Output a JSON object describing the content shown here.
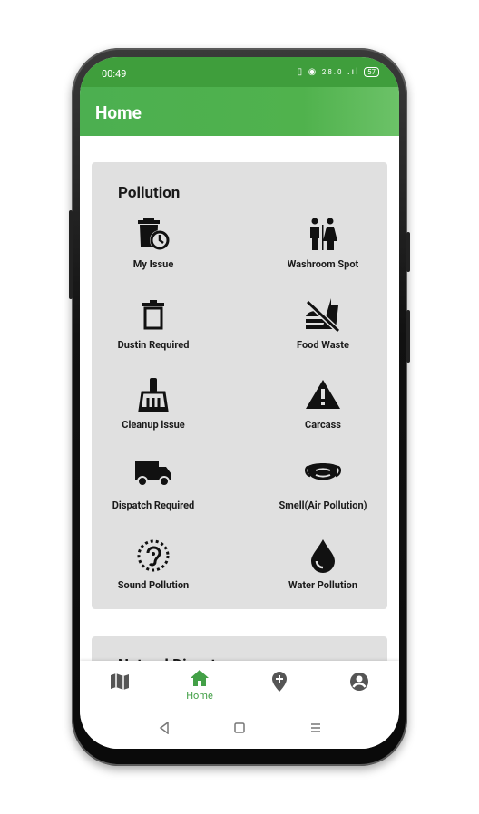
{
  "status_bar": {
    "time": "00:49",
    "icons_text": "28.0 KB/S ⁴ᴳ 4G",
    "battery": "57"
  },
  "app_bar": {
    "title": "Home"
  },
  "pollution_card": {
    "title": "Pollution",
    "items": [
      {
        "label": "My Issue",
        "icon": "trash-clock-icon"
      },
      {
        "label": "Washroom Spot",
        "icon": "washroom-icon"
      },
      {
        "label": "Dustin Required",
        "icon": "dustbin-icon"
      },
      {
        "label": "Food Waste",
        "icon": "no-food-icon"
      },
      {
        "label": "Cleanup issue",
        "icon": "broom-icon"
      },
      {
        "label": "Carcass",
        "icon": "warning-icon"
      },
      {
        "label": "Dispatch Required",
        "icon": "truck-icon"
      },
      {
        "label": "Smell(Air Pollution)",
        "icon": "mask-icon"
      },
      {
        "label": "Sound Pollution",
        "icon": "ear-icon"
      },
      {
        "label": "Water Pollution",
        "icon": "water-drop-icon"
      }
    ]
  },
  "next_card": {
    "title": "Natural Disast"
  },
  "bottom_nav": {
    "items": [
      {
        "label": "",
        "icon": "map-icon"
      },
      {
        "label": "Home",
        "icon": "home-icon"
      },
      {
        "label": "",
        "icon": "add-location-icon"
      },
      {
        "label": "",
        "icon": "account-icon"
      }
    ],
    "active": "Home",
    "accent": "#43a047"
  },
  "colors": {
    "primary": "#4caf50",
    "card_bg": "#e0e0e0"
  }
}
